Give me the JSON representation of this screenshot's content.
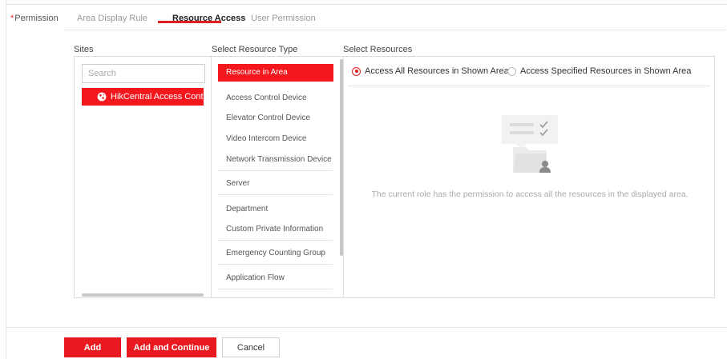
{
  "permission_label": "Permission",
  "tabs": [
    {
      "label": "Area Display Rule",
      "active": false
    },
    {
      "label": "Resource Access",
      "active": true
    },
    {
      "label": "User Permission",
      "active": false
    }
  ],
  "sites": {
    "title": "Sites",
    "search_placeholder": "Search",
    "items": [
      {
        "label": "HikCentral Access Control",
        "icon": "globe-icon",
        "selected": true
      }
    ]
  },
  "resource_type": {
    "title": "Select Resource Type",
    "items": [
      {
        "label": "Resource in Area",
        "selected": true
      },
      {
        "label": "Access Control Device",
        "selected": false
      },
      {
        "label": "Elevator Control Device",
        "selected": false
      },
      {
        "label": "Video Intercom Device",
        "selected": false
      },
      {
        "label": "Network Transmission Device",
        "selected": false
      },
      {
        "label": "Server",
        "selected": false
      },
      {
        "label": "Department",
        "selected": false
      },
      {
        "label": "Custom Private Information",
        "selected": false
      },
      {
        "label": "Emergency Counting Group",
        "selected": false
      },
      {
        "label": "Application Flow",
        "selected": false
      }
    ]
  },
  "resources": {
    "title": "Select Resources",
    "options": [
      {
        "label": "Access All Resources in Shown Area",
        "checked": true
      },
      {
        "label": "Access Specified Resources in Shown Area",
        "checked": false
      }
    ],
    "empty_message": "The current role has the permission to access all the resources in the displayed area."
  },
  "footer": {
    "add_label": "Add",
    "add_continue_label": "Add and Continue",
    "cancel_label": "Cancel"
  },
  "colors": {
    "accent": "#e8191f",
    "border": "#dcdcdc"
  }
}
